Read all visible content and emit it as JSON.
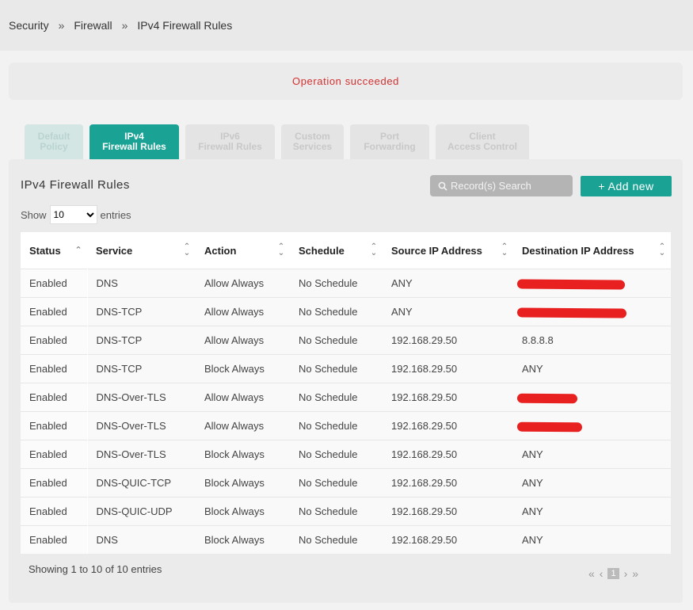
{
  "breadcrumb": {
    "items": [
      "Security",
      "Firewall",
      "IPv4 Firewall Rules"
    ],
    "separator": "»"
  },
  "alert": {
    "message": "Operation succeeded"
  },
  "tabs": [
    {
      "line1": "Default",
      "line2": "Policy",
      "state": "disabled"
    },
    {
      "line1": "IPv4",
      "line2": "Firewall Rules",
      "state": "active"
    },
    {
      "line1": "IPv6",
      "line2": "Firewall Rules",
      "state": "inactive"
    },
    {
      "line1": "Custom",
      "line2": "Services",
      "state": "inactive"
    },
    {
      "line1": "Port",
      "line2": "Forwarding",
      "state": "inactive"
    },
    {
      "line1": "Client",
      "line2": "Access Control",
      "state": "inactive"
    }
  ],
  "panel": {
    "title": "IPv4 Firewall Rules",
    "search_placeholder": "Record(s) Search",
    "add_button": "+ Add new",
    "show_label": "Show",
    "entries_label": "entries",
    "page_size": "10"
  },
  "table": {
    "columns": [
      "Status",
      "Service",
      "Action",
      "Schedule",
      "Source IP Address",
      "Destination IP Address"
    ],
    "rows": [
      {
        "status": "Enabled",
        "service": "DNS",
        "action": "Allow Always",
        "schedule": "No Schedule",
        "source": "ANY",
        "destination": "",
        "redacted": true
      },
      {
        "status": "Enabled",
        "service": "DNS-TCP",
        "action": "Allow Always",
        "schedule": "No Schedule",
        "source": "ANY",
        "destination": "",
        "redacted": true
      },
      {
        "status": "Enabled",
        "service": "DNS-TCP",
        "action": "Allow Always",
        "schedule": "No Schedule",
        "source": "192.168.29.50",
        "destination": "8.8.8.8",
        "redacted": false
      },
      {
        "status": "Enabled",
        "service": "DNS-TCP",
        "action": "Block Always",
        "schedule": "No Schedule",
        "source": "192.168.29.50",
        "destination": "ANY",
        "redacted": false
      },
      {
        "status": "Enabled",
        "service": "DNS-Over-TLS",
        "action": "Allow Always",
        "schedule": "No Schedule",
        "source": "192.168.29.50",
        "destination": "",
        "redacted": true
      },
      {
        "status": "Enabled",
        "service": "DNS-Over-TLS",
        "action": "Allow Always",
        "schedule": "No Schedule",
        "source": "192.168.29.50",
        "destination": "",
        "redacted": true
      },
      {
        "status": "Enabled",
        "service": "DNS-Over-TLS",
        "action": "Block Always",
        "schedule": "No Schedule",
        "source": "192.168.29.50",
        "destination": "ANY",
        "redacted": false
      },
      {
        "status": "Enabled",
        "service": "DNS-QUIC-TCP",
        "action": "Block Always",
        "schedule": "No Schedule",
        "source": "192.168.29.50",
        "destination": "ANY",
        "redacted": false
      },
      {
        "status": "Enabled",
        "service": "DNS-QUIC-UDP",
        "action": "Block Always",
        "schedule": "No Schedule",
        "source": "192.168.29.50",
        "destination": "ANY",
        "redacted": false
      },
      {
        "status": "Enabled",
        "service": "DNS",
        "action": "Block Always",
        "schedule": "No Schedule",
        "source": "192.168.29.50",
        "destination": "ANY",
        "redacted": false
      }
    ]
  },
  "footer": {
    "info": "Showing 1 to 10 of 10 entries",
    "pager": {
      "first": "«",
      "prev": "‹",
      "current": "1",
      "next": "›",
      "last": "»"
    }
  },
  "colors": {
    "accent": "#1aa394",
    "alert_text": "#d32f2f",
    "redaction": "#e82020"
  }
}
